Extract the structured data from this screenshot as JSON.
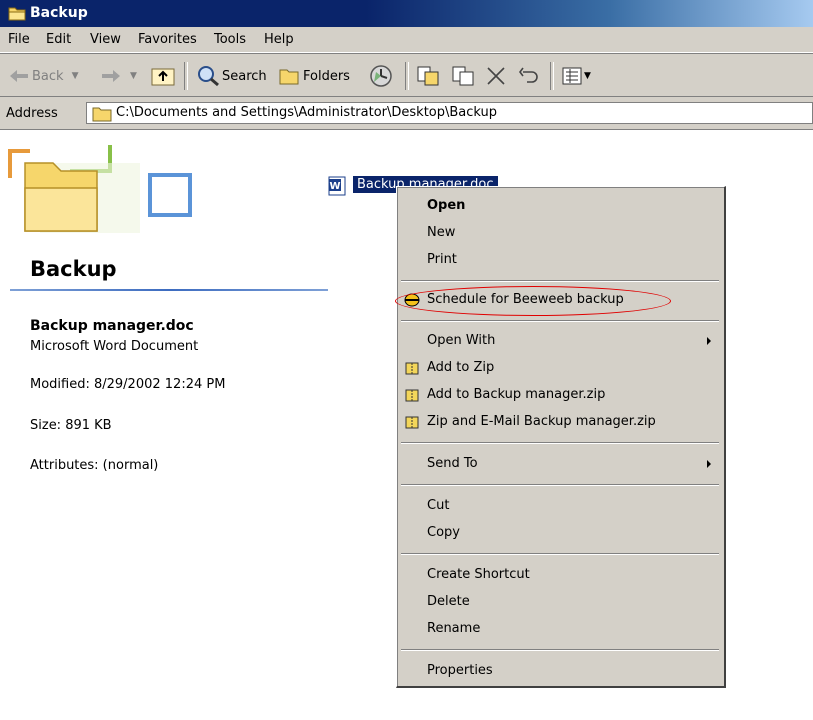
{
  "window": {
    "title": "Backup"
  },
  "menubar": {
    "items": [
      "File",
      "Edit",
      "View",
      "Favorites",
      "Tools",
      "Help"
    ]
  },
  "toolbar": {
    "back_label": "Back",
    "search_label": "Search",
    "folders_label": "Folders"
  },
  "address": {
    "label": "Address",
    "value": "C:\\Documents and Settings\\Administrator\\Desktop\\Backup"
  },
  "left_panel": {
    "title": "Backup",
    "file_name": "Backup manager.doc",
    "file_type": "Microsoft Word Document",
    "modified": "Modified: 8/29/2002 12:24 PM",
    "size": "Size: 891 KB",
    "attributes": "Attributes: (normal)"
  },
  "file_item": {
    "label": "Backup manager.doc"
  },
  "context_menu": {
    "open": "Open",
    "new": "New",
    "print": "Print",
    "schedule": "Schedule for Beeweeb backup",
    "open_with": "Open With",
    "add_to_zip": "Add to Zip",
    "add_to_named_zip": "Add to Backup manager.zip",
    "zip_email": "Zip and E-Mail Backup manager.zip",
    "send_to": "Send To",
    "cut": "Cut",
    "copy": "Copy",
    "create_shortcut": "Create Shortcut",
    "delete": "Delete",
    "rename": "Rename",
    "properties": "Properties"
  },
  "colors": {
    "titlebar": "#0a246a",
    "chrome": "#d4d0c8",
    "highlight": "#0a246a",
    "annotation": "#e00000"
  }
}
